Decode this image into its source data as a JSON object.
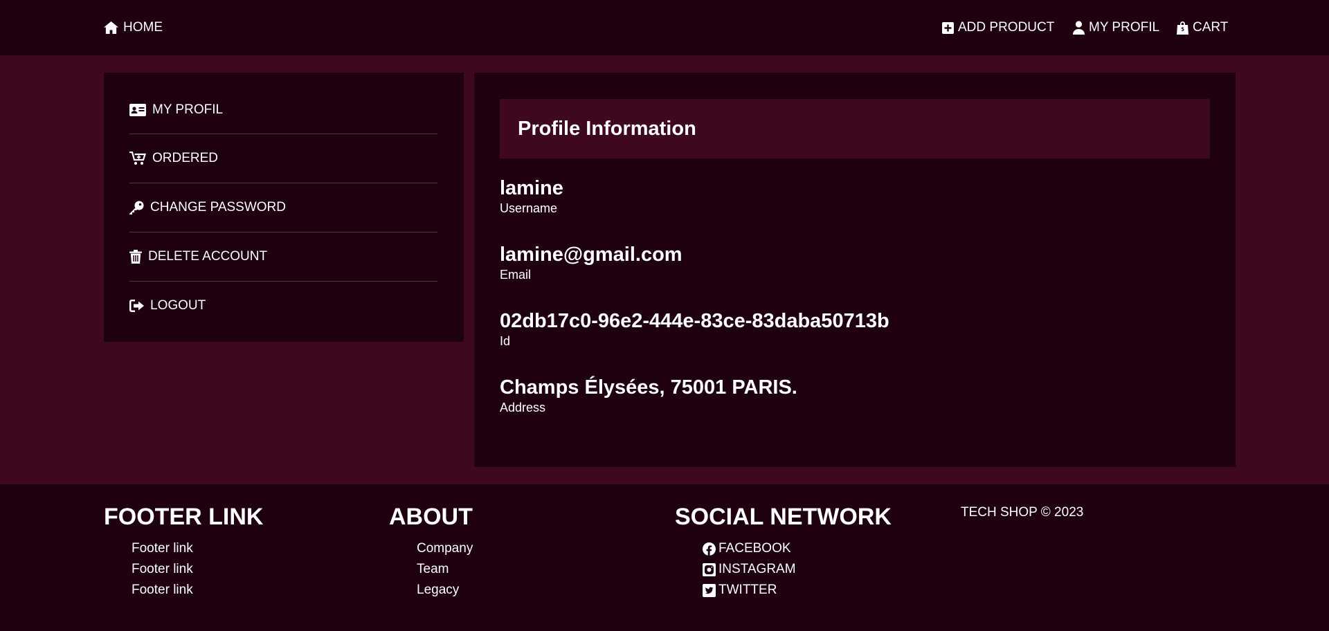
{
  "nav": {
    "home": "HOME",
    "add_product": "ADD PRODUCT",
    "my_profil": "MY PROFIL",
    "cart": "CART"
  },
  "sidebar": {
    "items": [
      {
        "label": "MY PROFIL",
        "icon": "id-card-icon"
      },
      {
        "label": "ORDERED",
        "icon": "cart-plus-icon"
      },
      {
        "label": "CHANGE PASSWORD",
        "icon": "key-icon"
      },
      {
        "label": "DELETE ACCOUNT",
        "icon": "trash-icon"
      },
      {
        "label": "LOGOUT",
        "icon": "logout-icon"
      }
    ]
  },
  "profile": {
    "title": "Profile Information",
    "fields": [
      {
        "value": "lamine",
        "label": "Username"
      },
      {
        "value": "lamine@gmail.com",
        "label": "Email"
      },
      {
        "value": "02db17c0-96e2-444e-83ce-83daba50713b",
        "label": "Id"
      },
      {
        "value": "Champs Élysées, 75001 PARIS.",
        "label": "Address"
      }
    ]
  },
  "footer": {
    "footer_link": {
      "heading": "FOOTER LINK",
      "links": [
        "Footer link",
        "Footer link",
        "Footer link"
      ]
    },
    "about": {
      "heading": "ABOUT",
      "links": [
        "Company",
        "Team",
        "Legacy"
      ]
    },
    "social": {
      "heading": "SOCIAL NETWORK",
      "links": [
        {
          "label": "FACEBOOK",
          "icon": "facebook-icon"
        },
        {
          "label": "INSTAGRAM",
          "icon": "instagram-icon"
        },
        {
          "label": "TWITTER",
          "icon": "twitter-icon"
        }
      ]
    },
    "copyright": "TECH SHOP © 2023"
  },
  "colors": {
    "page_background": "#3d0820",
    "panel_background": "#1e0010",
    "text": "#ffffff"
  }
}
